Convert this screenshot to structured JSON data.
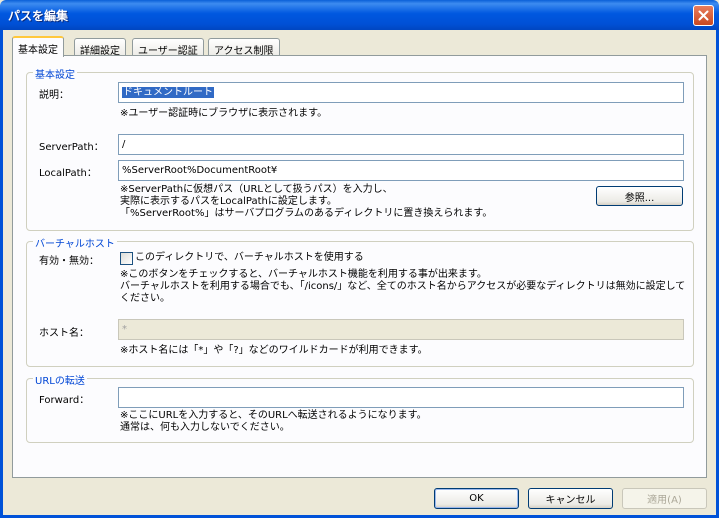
{
  "window": {
    "title": "パスを編集"
  },
  "tabs": [
    {
      "label": "基本設定"
    },
    {
      "label": "詳細設定"
    },
    {
      "label": "ユーザー認証"
    },
    {
      "label": "アクセス制限"
    }
  ],
  "basic": {
    "group_title": "基本設定",
    "description_label": "説明：",
    "description_value": "ドキュメントルート",
    "description_note": "※ユーザー認証時にブラウザに表示されます。",
    "serverpath_label": "ServerPath：",
    "serverpath_value": "/",
    "localpath_label": "LocalPath：",
    "localpath_value": "%ServerRoot%DocumentRoot¥",
    "localpath_note_1": "※ServerPathに仮想パス（URLとして扱うパス）を入力し、",
    "localpath_note_2": "実際に表示するパスをLocalPathに設定します。",
    "localpath_note_3": "「%ServerRoot%」はサーバプログラムのあるディレクトリに置き換えられます。",
    "browse_label": "参照..."
  },
  "virtualhost": {
    "group_title": "バーチャルホスト",
    "enable_label": "有効・無効：",
    "checkbox_label": "このディレクトリで、バーチャルホストを使用する",
    "note_1": "※このボタンをチェックすると、バーチャルホスト機能を利用する事が出来ます。",
    "note_2": "バーチャルホストを利用する場合でも、「/icons/」など、全てのホスト名からアクセスが必要なディレクトリは無効に設定して",
    "note_3": "ください。",
    "hostname_label": "ホスト名：",
    "hostname_value": "*",
    "hostname_note": "※ホスト名には「*」や「?」などのワイルドカードが利用できます。"
  },
  "forward": {
    "group_title": "URLの転送",
    "forward_label": "Forward：",
    "forward_value": "",
    "note_1": "※ここにURLを入力すると、そのURLへ転送されるようになります。",
    "note_2": "通常は、何も入力しないでください。"
  },
  "footer": {
    "ok_label": "OK",
    "cancel_label": "キャンセル",
    "apply_label": "適用(A)"
  },
  "icons": {
    "close": "close-icon"
  },
  "colors": {
    "titlebar": "#0058e0",
    "group_title": "#0046d5",
    "selection": "#316ac5"
  }
}
